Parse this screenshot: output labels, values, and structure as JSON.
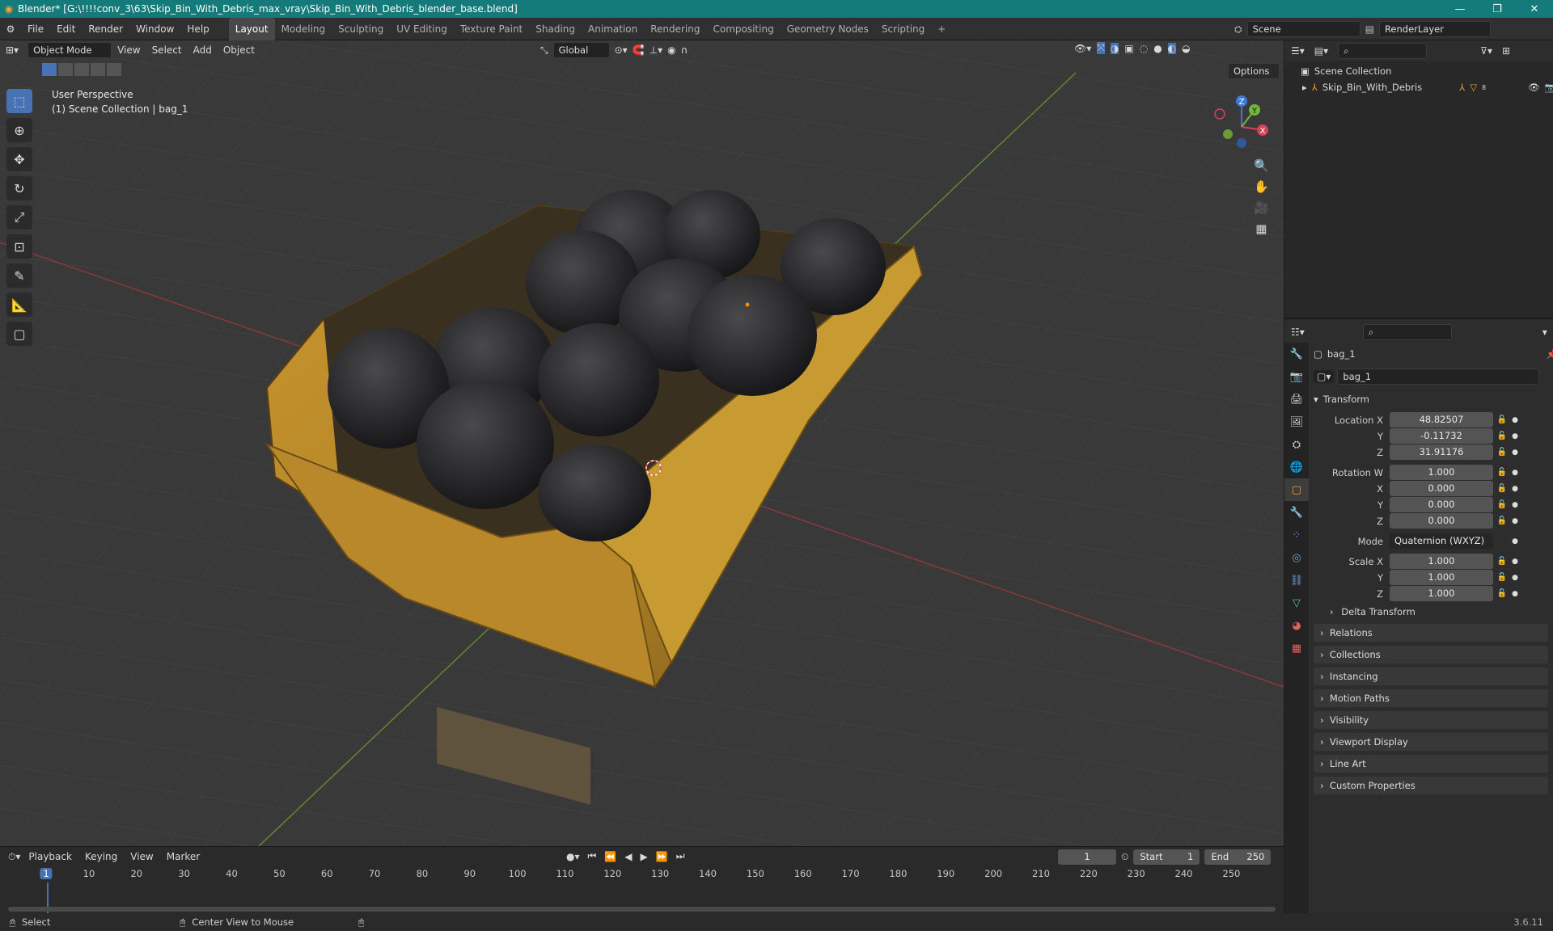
{
  "title": "Blender* [G:\\!!!!conv_3\\63\\Skip_Bin_With_Debris_max_vray\\Skip_Bin_With_Debris_blender_base.blend]",
  "menu": [
    "File",
    "Edit",
    "Render",
    "Window",
    "Help"
  ],
  "workspaces": [
    "Layout",
    "Modeling",
    "Sculpting",
    "UV Editing",
    "Texture Paint",
    "Shading",
    "Animation",
    "Rendering",
    "Compositing",
    "Geometry Nodes",
    "Scripting"
  ],
  "active_workspace": "Layout",
  "scene": "Scene",
  "render_layer": "RenderLayer",
  "viewport": {
    "mode": "Object Mode",
    "menus": [
      "View",
      "Select",
      "Add",
      "Object"
    ],
    "orientation": "Global",
    "options": "Options",
    "overlay_line1": "User Perspective",
    "overlay_line2": "(1) Scene Collection | bag_1",
    "gizmo_labels": {
      "z": "Z",
      "y": "Y",
      "x": "X"
    }
  },
  "outliner": {
    "root": "Scene Collection",
    "item": "Skip_Bin_With_Debris",
    "item_badge": "8"
  },
  "properties": {
    "object_name": "bag_1",
    "data_name": "bag_1",
    "transform_label": "Transform",
    "location_label": "Location X",
    "location": [
      "48.82507",
      "-0.11732",
      "31.91176"
    ],
    "rotation_label": "Rotation W",
    "rotation": [
      "1.000",
      "0.000",
      "0.000",
      "0.000"
    ],
    "mode_label": "Mode",
    "mode_value": "Quaternion (WXYZ)",
    "scale_label": "Scale X",
    "scale": [
      "1.000",
      "1.000",
      "1.000"
    ],
    "axis_y": "Y",
    "axis_z": "Z",
    "axis_x": "X",
    "delta": "Delta Transform",
    "sections": [
      "Relations",
      "Collections",
      "Instancing",
      "Motion Paths",
      "Visibility",
      "Viewport Display",
      "Line Art",
      "Custom Properties"
    ]
  },
  "timeline": {
    "menus": [
      "Playback",
      "Keying",
      "View",
      "Marker"
    ],
    "current_frame": "1",
    "start_label": "Start",
    "start": "1",
    "end_label": "End",
    "end": "250",
    "ticks": [
      "1",
      "10",
      "20",
      "30",
      "40",
      "50",
      "60",
      "70",
      "80",
      "90",
      "100",
      "110",
      "120",
      "130",
      "140",
      "150",
      "160",
      "170",
      "180",
      "190",
      "200",
      "210",
      "220",
      "230",
      "240",
      "250"
    ]
  },
  "status": {
    "select": "Select",
    "center": "Center View to Mouse",
    "version": "3.6.11"
  }
}
